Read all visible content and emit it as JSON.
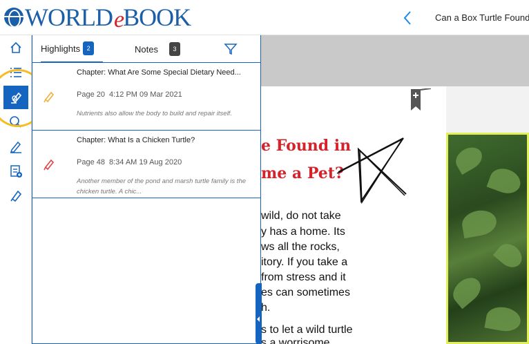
{
  "header": {
    "logo_text_world": "WORLD",
    "logo_text_e": "e",
    "logo_text_book": "BOOK",
    "book_title": "Can a Box Turtle Found"
  },
  "rail": {
    "items": [
      {
        "icon": "home-icon"
      },
      {
        "icon": "list-icon"
      },
      {
        "icon": "highlighter-icon",
        "active": true
      },
      {
        "icon": "search-icon"
      },
      {
        "icon": "pen-icon"
      },
      {
        "icon": "add-note-icon"
      },
      {
        "icon": "marker-icon"
      }
    ]
  },
  "panel": {
    "tabs": {
      "highlights": {
        "label": "Highlights",
        "count": "2"
      },
      "notes": {
        "label": "Notes",
        "count": "3"
      }
    },
    "items": [
      {
        "chapter": "Chapter: What Are Some Special Dietary Need...",
        "page": "Page 20",
        "timestamp": "4:12 PM 09 Mar 2021",
        "excerpt": "Nutrients also allow the body to build and repair itself.",
        "pen_color": "#f0b23a"
      },
      {
        "chapter": "Chapter: What Is a Chicken Turtle?",
        "page": "Page 48",
        "timestamp": "8:34 AM 19 Aug 2020",
        "excerpt": "Another member of the pond and marsh turtle family is the chicken turtle. A chic...",
        "pen_color": "#e0444a"
      }
    ]
  },
  "book": {
    "heading_line1": "e Found in",
    "heading_line2": "me a Pet?",
    "body_lines": [
      "wild, do not take",
      "y has a home. Its",
      "ws all the rocks,",
      "itory. If you take a",
      " from stress and it",
      "es can sometimes",
      "h.",
      "s to let a wild turtle",
      "s a worrisome"
    ]
  },
  "colors": {
    "accent": "#1565c0",
    "annotation_circle": "#f5bd23",
    "heading_red": "#d4232a"
  }
}
